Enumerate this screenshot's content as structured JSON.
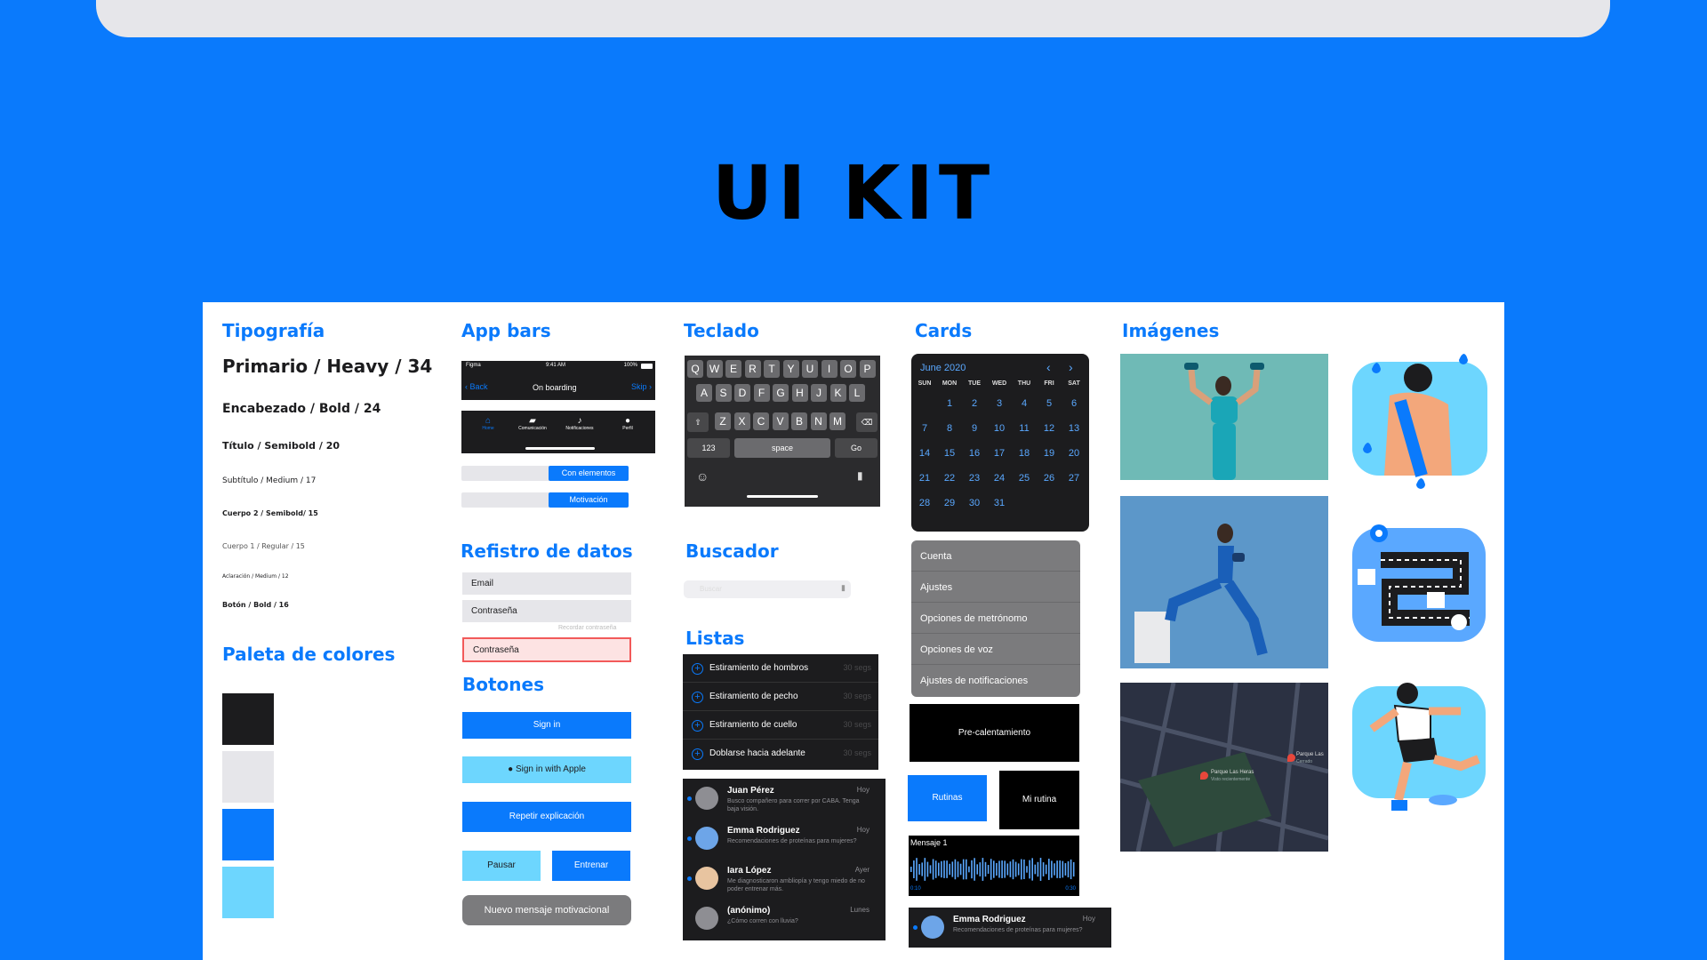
{
  "page": {
    "title": "UI KIT"
  },
  "sections": {
    "typography": "Tipografía",
    "palette": "Paleta de colores",
    "appbars": "App bars",
    "register": "Refistro de datos",
    "buttons": "Botones",
    "keyboard": "Teclado",
    "search": "Buscador",
    "lists": "Listas",
    "cards": "Cards",
    "images": "Imágenes"
  },
  "typography": [
    "Primario / Heavy / 34",
    "Encabezado / Bold / 24",
    "Título / Semibold / 20",
    "Subtítulo / Medium / 17",
    "Cuerpo 2 / Semibold/  15",
    "Cuerpo 1 / Regular / 15",
    "Aclaración / Medium / 12",
    "Botón / Bold / 16"
  ],
  "palette": [
    "#1C1C1E",
    "#E6E6EA",
    "#0A7AFC",
    "#6DD6FE"
  ],
  "appbars": {
    "status_carrier": "Figma",
    "status_time": "9:41 AM",
    "status_battery": "100%",
    "nav_back": "Back",
    "nav_title": "On boarding",
    "nav_skip": "Skip",
    "tabs": [
      "Home",
      "Comunicación",
      "Notificaciones",
      "Perfil"
    ],
    "seg1": "Con elementos",
    "seg2": "Motivación"
  },
  "register": {
    "email": "Email",
    "password": "Contraseña",
    "password_error": "Contraseña",
    "hint": "Recordar contraseña"
  },
  "buttons": {
    "signin": "Sign in",
    "apple": "Sign in with Apple",
    "repeat": "Repetir explicación",
    "pause": "Pausar",
    "train": "Entrenar",
    "new_msg": "Nuevo mensaje motivacional"
  },
  "keyboard": {
    "row1": [
      "Q",
      "W",
      "E",
      "R",
      "T",
      "Y",
      "U",
      "I",
      "O",
      "P"
    ],
    "row2": [
      "A",
      "S",
      "D",
      "F",
      "G",
      "H",
      "J",
      "K",
      "L"
    ],
    "row3": [
      "Z",
      "X",
      "C",
      "V",
      "B",
      "N",
      "M"
    ],
    "num": "123",
    "space": "space",
    "go": "Go"
  },
  "search": {
    "placeholder": "Buscar"
  },
  "list_items": [
    {
      "label": "Estiramiento de hombros",
      "time": "30 segs"
    },
    {
      "label": "Estiramiento de pecho",
      "time": "30 segs"
    },
    {
      "label": "Estiramiento de cuello",
      "time": "30 segs"
    },
    {
      "label": "Doblarse hacia adelante",
      "time": "30 segs"
    }
  ],
  "messages": [
    {
      "name": "Juan Pérez",
      "preview": "Busco compañero para correr por CABA. Tenga baja visión.",
      "time": "Hoy"
    },
    {
      "name": "Emma Rodriguez",
      "preview": "Recomendaciones de proteínas para mujeres?",
      "time": "Hoy"
    },
    {
      "name": "Iara López",
      "preview": "Me diagnosticaron ambliopía y tengo miedo de no poder entrenar más.",
      "time": "Ayer"
    },
    {
      "name": "(anónimo)",
      "preview": "¿Cómo corren con lluvia?",
      "time": "Lunes"
    }
  ],
  "calendar": {
    "month": "June 2020",
    "weekdays": [
      "SUN",
      "MON",
      "TUE",
      "WED",
      "THU",
      "FRI",
      "SAT"
    ],
    "days": [
      "1",
      "2",
      "3",
      "4",
      "5",
      "6",
      "7",
      "8",
      "9",
      "10",
      "11",
      "12",
      "13",
      "14",
      "15",
      "16",
      "17",
      "18",
      "19",
      "20",
      "21",
      "22",
      "23",
      "24",
      "25",
      "26",
      "27",
      "28",
      "29",
      "30",
      "31"
    ]
  },
  "menu": [
    "Cuenta",
    "Ajustes",
    "Opciones de metrónomo",
    "Opciones de voz",
    "Ajustes de notificaciones"
  ],
  "cards": {
    "warmup": "Pre-calentamiento",
    "routines": "Rutinas",
    "my_routine": "Mi rutina",
    "audio_title": "Mensaje 1",
    "audio_start": "0:10",
    "audio_end": "0:30",
    "notif_name": "Emma Rodriguez",
    "notif_preview": "Recomendaciones de proteínas para mujeres?",
    "notif_time": "Hoy"
  },
  "map": {
    "place1": "Parque Las Heras",
    "place1_sub": "Visto recientemente",
    "place2": "Parque Las",
    "place2_sub": "Cerrado"
  }
}
